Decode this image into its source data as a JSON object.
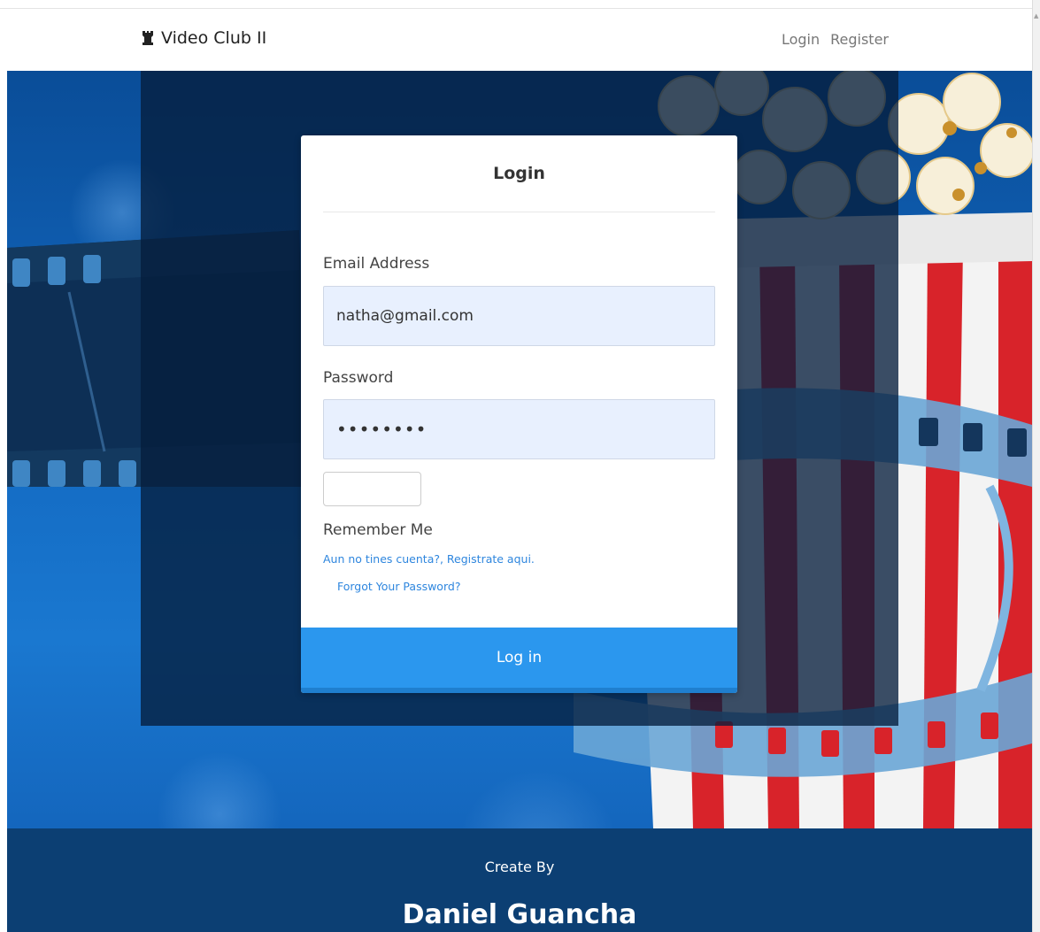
{
  "navbar": {
    "brand_icon": "rook-icon",
    "brand": "Video Club II",
    "links": [
      "Login",
      "Register"
    ]
  },
  "login_card": {
    "title": "Login",
    "email_label": "Email Address",
    "email_value": "natha@gmail.com",
    "password_label": "Password",
    "password_value": "natha123",
    "remember_label": "Remember Me",
    "register_link": "Aun no tines cuenta?, Registrate aqui.",
    "forgot_link": "Forgot Your Password?",
    "submit_label": "Log in"
  },
  "footer": {
    "caption": "Create By",
    "author": "Daniel Guancha"
  },
  "colors": {
    "primary_button": "#2b97ee",
    "link": "#2e86de",
    "footer_bg": "#0c3f73",
    "input_bg": "#e8f0fe"
  }
}
